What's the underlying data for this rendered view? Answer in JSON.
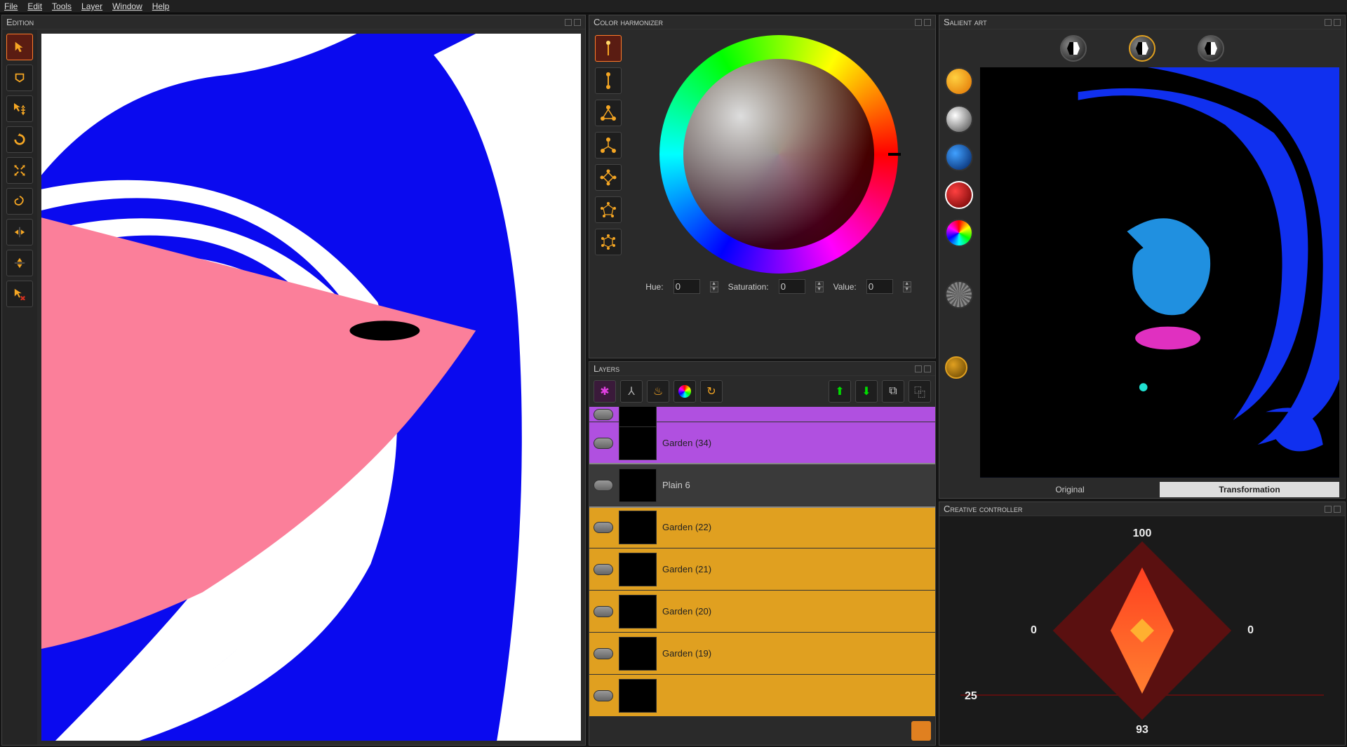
{
  "menu": {
    "file": "File",
    "edit": "Edit",
    "tools": "Tools",
    "layer": "Layer",
    "window": "Window",
    "help": "Help"
  },
  "panels": {
    "edition": "Edition",
    "color_harmonizer": "Color harmonizer",
    "layers": "Layers",
    "salient_art": "Salient art",
    "creative_controller": "Creative controller"
  },
  "harmonizer": {
    "hue_label": "Hue:",
    "hue": "0",
    "sat_label": "Saturation:",
    "sat": "0",
    "val_label": "Value:",
    "val": "0"
  },
  "layers": [
    {
      "name": "",
      "color": "purple"
    },
    {
      "name": "Garden (34)",
      "color": "purple"
    },
    {
      "name": "Plain 6",
      "color": "dark",
      "selected": true
    },
    {
      "name": "Garden (22)",
      "color": "gold"
    },
    {
      "name": "Garden (21)",
      "color": "gold"
    },
    {
      "name": "Garden (20)",
      "color": "gold"
    },
    {
      "name": "Garden (19)",
      "color": "gold"
    },
    {
      "name": "",
      "color": "gold"
    }
  ],
  "salient": {
    "original": "Original",
    "transformation": "Transformation"
  },
  "controller": {
    "top": "100",
    "left": "0",
    "right": "0",
    "bottom": "93",
    "slider": "25"
  }
}
